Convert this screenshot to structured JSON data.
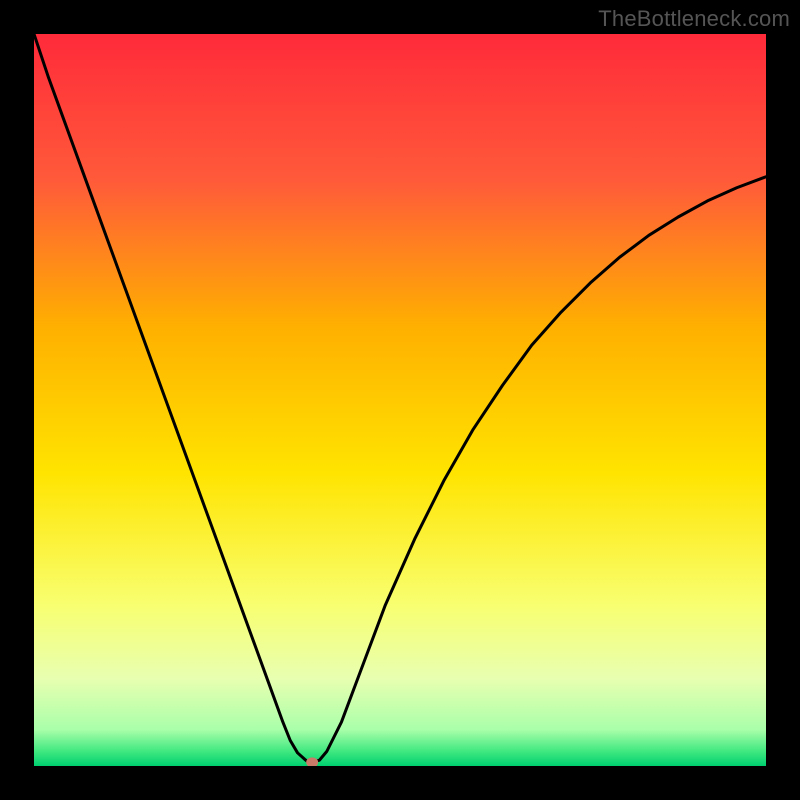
{
  "watermark": "TheBottleneck.com",
  "chart_data": {
    "type": "line",
    "title": "",
    "xlabel": "",
    "ylabel": "",
    "xlim": [
      0,
      100
    ],
    "ylim": [
      0,
      100
    ],
    "grid": false,
    "legend": false,
    "background_gradient_stops": [
      {
        "pos": 0.0,
        "color": "#ff2a3a"
      },
      {
        "pos": 0.2,
        "color": "#ff5a3a"
      },
      {
        "pos": 0.4,
        "color": "#ffb000"
      },
      {
        "pos": 0.6,
        "color": "#ffe400"
      },
      {
        "pos": 0.78,
        "color": "#f8ff70"
      },
      {
        "pos": 0.88,
        "color": "#e8ffb0"
      },
      {
        "pos": 0.95,
        "color": "#aaffaa"
      },
      {
        "pos": 0.98,
        "color": "#40e880"
      },
      {
        "pos": 1.0,
        "color": "#00d070"
      }
    ],
    "marker": {
      "x": 38,
      "y": 0.5,
      "color": "#c97a68",
      "rx": 6,
      "ry": 5
    },
    "series": [
      {
        "name": "left-branch",
        "x": [
          0,
          2,
          4,
          6,
          8,
          10,
          12,
          14,
          16,
          18,
          20,
          22,
          24,
          26,
          28,
          30,
          32,
          34,
          35,
          36,
          37,
          37.5,
          38
        ],
        "y": [
          100,
          94,
          88.5,
          83,
          77.5,
          72,
          66.5,
          61,
          55.5,
          50,
          44.5,
          39,
          33.5,
          28,
          22.5,
          17,
          11.5,
          6,
          3.5,
          1.8,
          0.9,
          0.5,
          0.5
        ]
      },
      {
        "name": "right-branch",
        "x": [
          38,
          39,
          40,
          42,
          45,
          48,
          52,
          56,
          60,
          64,
          68,
          72,
          76,
          80,
          84,
          88,
          92,
          96,
          100
        ],
        "y": [
          0.5,
          0.8,
          2,
          6,
          14,
          22,
          31,
          39,
          46,
          52,
          57.5,
          62,
          66,
          69.5,
          72.5,
          75,
          77.2,
          79,
          80.5
        ]
      }
    ]
  }
}
